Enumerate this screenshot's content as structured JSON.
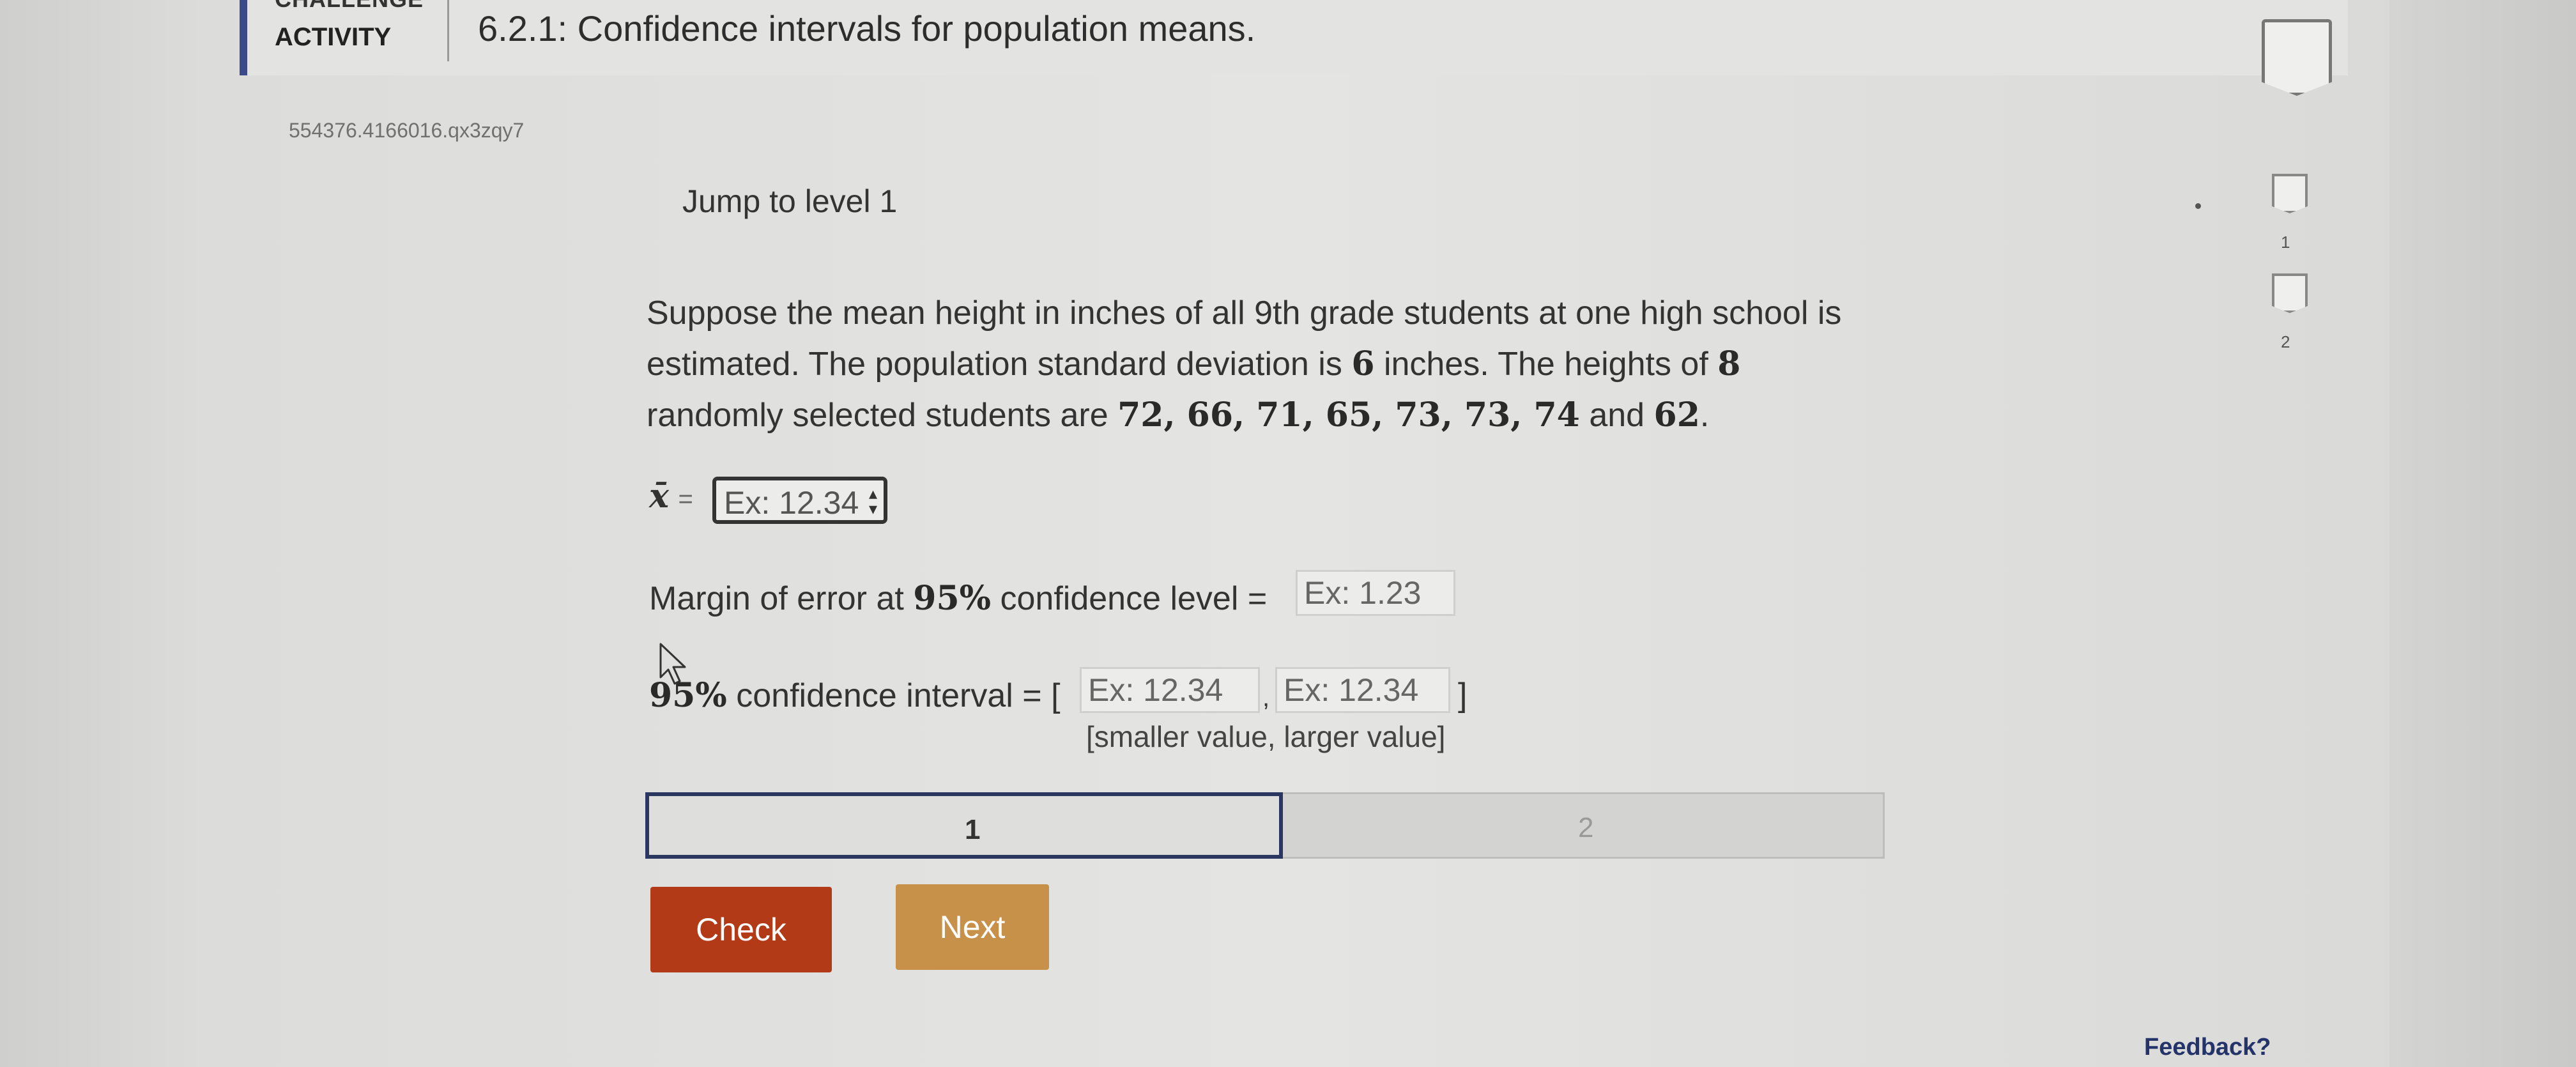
{
  "header": {
    "challenge_label": "CHALLENGE",
    "activity_label": "ACTIVITY",
    "title": "6.2.1: Confidence intervals for population means."
  },
  "activity_id": "554376.4166016.qx3zqy7",
  "jump_to_level": "Jump to level 1",
  "levels": [
    "1",
    "2"
  ],
  "problem": {
    "line1": "Suppose the mean height in inches of all 9th grade students at one high school is",
    "line2_a": "estimated. The population standard deviation is ",
    "std_dev": "6",
    "line2_b": " inches. The heights of ",
    "n": "8",
    "line3_a": "randomly selected students are ",
    "values": "72, 66, 71, 65, 73, 73, 74",
    "line3_and": " and ",
    "last_value": "62",
    "line3_end": "."
  },
  "mean_row": {
    "symbol": "x̄",
    "equals": "=",
    "placeholder": "Ex: 12.34"
  },
  "margin_row": {
    "label_a": "Margin of error at ",
    "level": "95%",
    "label_b": " confidence level =",
    "placeholder": "Ex: 1.23"
  },
  "interval_row": {
    "level": "95%",
    "label": " confidence interval = [",
    "placeholder_low": "Ex: 12.34",
    "comma": ",",
    "placeholder_high": "Ex: 12.34",
    "close": "]",
    "hint": "[smaller value, larger value]"
  },
  "progress": {
    "segments": [
      "1",
      "2"
    ],
    "current": 1
  },
  "buttons": {
    "check": "Check",
    "next": "Next"
  },
  "feedback": "Feedback?",
  "colors": {
    "check": "#b33a17",
    "next": "#c8914a",
    "accent": "#3d4a8a",
    "feedback": "#24336a"
  },
  "icons": [
    "completion-check-icon",
    "level-1-check-icon",
    "level-2-check-icon",
    "spinner-arrows-icon",
    "mouse-cursor-icon"
  ]
}
